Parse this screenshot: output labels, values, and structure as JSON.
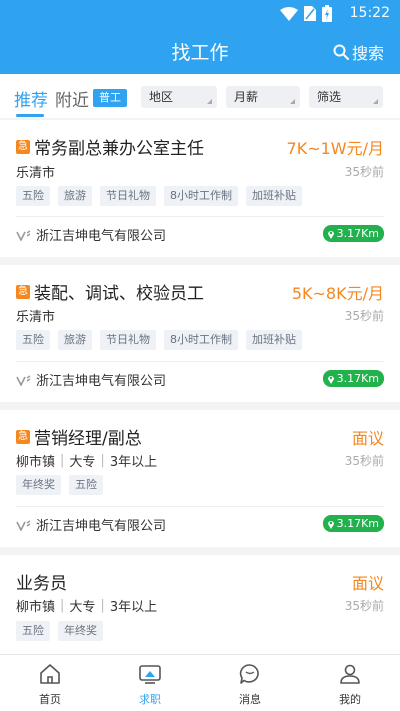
{
  "status_bar": {
    "time": "15:22"
  },
  "header": {
    "title": "找工作",
    "search_label": "搜索"
  },
  "filters": {
    "tabs": [
      {
        "label": "推荐",
        "active": true
      },
      {
        "label": "附近",
        "active": false
      }
    ],
    "chip": "普工",
    "dropdowns": [
      "地区",
      "月薪",
      "筛选"
    ]
  },
  "colors": {
    "primary": "#2fa3f0",
    "salary": "#f5871f",
    "distance_badge": "#22b14c",
    "urgent": "#f5871f"
  },
  "jobs": [
    {
      "urgent": true,
      "urgent_mark": "急",
      "title": "常务副总兼办公室主任",
      "salary": "7K~1W元/月",
      "meta": [
        "乐清市"
      ],
      "time": "35秒前",
      "tags": [
        "五险",
        "旅游",
        "节日礼物",
        "8小时工作制",
        "加班补贴"
      ],
      "company": "浙江吉坤电气有限公司",
      "distance": "3.17Km"
    },
    {
      "urgent": true,
      "urgent_mark": "急",
      "title": "装配、调试、校验员工",
      "salary": "5K~8K元/月",
      "meta": [
        "乐清市"
      ],
      "time": "35秒前",
      "tags": [
        "五险",
        "旅游",
        "节日礼物",
        "8小时工作制",
        "加班补贴"
      ],
      "company": "浙江吉坤电气有限公司",
      "distance": "3.17Km"
    },
    {
      "urgent": true,
      "urgent_mark": "急",
      "title": "营销经理/副总",
      "salary": "面议",
      "meta": [
        "柳市镇",
        "大专",
        "3年以上"
      ],
      "time": "35秒前",
      "tags": [
        "年终奖",
        "五险"
      ],
      "company": "浙江吉坤电气有限公司",
      "distance": "3.17Km"
    },
    {
      "urgent": false,
      "title": "业务员",
      "salary": "面议",
      "meta": [
        "柳市镇",
        "大专",
        "3年以上"
      ],
      "time": "35秒前",
      "tags": [
        "五险",
        "年终奖"
      ]
    }
  ],
  "bottom_nav": [
    {
      "label": "首页",
      "icon": "home-icon",
      "active": false
    },
    {
      "label": "求职",
      "icon": "job-search-icon",
      "active": true
    },
    {
      "label": "消息",
      "icon": "message-icon",
      "active": false
    },
    {
      "label": "我的",
      "icon": "profile-icon",
      "active": false
    }
  ]
}
